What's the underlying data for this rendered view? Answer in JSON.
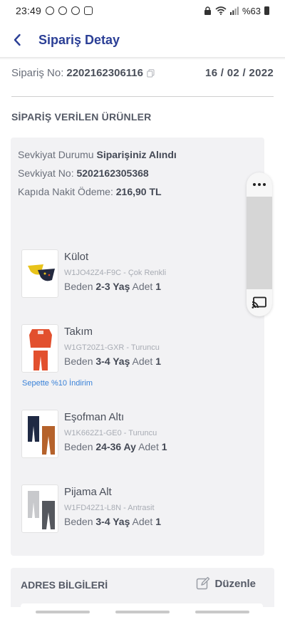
{
  "status_bar": {
    "time": "23:49",
    "battery_text": "%63",
    "icons": [
      "message-icon",
      "whatsapp-icon",
      "whatsapp-icon",
      "instagram-icon",
      "lock-icon",
      "wifi-icon",
      "signal-icon",
      "battery-icon"
    ]
  },
  "header": {
    "title": "Sipariş Detay",
    "back_icon": "chevron-left-icon"
  },
  "order": {
    "label": "Sipariş No:",
    "number": "2202162306116",
    "date": "16 / 02 / 2022"
  },
  "products_section": {
    "title": "SİPARİŞ VERİLEN ÜRÜNLER",
    "shipping_status_label": "Sevkiyat Durumu",
    "shipping_status_value": "Siparişiniz Alındı",
    "shipping_no_label": "Sevkiyat No:",
    "shipping_no_value": "5202162305368",
    "payment_label": "Kapıda Nakit Ödeme:",
    "payment_value": "216,90 TL",
    "items": [
      {
        "name": "Külot",
        "sku": "W1JO42Z4-F9C - Çok Renkli",
        "size_label": "Beden",
        "size": "2-3 Yaş",
        "qty_label": "Adet",
        "qty": "1"
      },
      {
        "name": "Takım",
        "sku": "W1GT20Z1-GXR - Turuncu",
        "size_label": "Beden",
        "size": "3-4 Yaş",
        "qty_label": "Adet",
        "qty": "1"
      },
      {
        "name": "Eşofman Altı",
        "sku": "W1K662Z1-GE0 - Turuncu",
        "size_label": "Beden",
        "size": "24-36 Ay",
        "qty_label": "Adet",
        "qty": "1"
      },
      {
        "name": "Pijama Alt",
        "sku": "W1FD42Z1-L8N - Antrasit",
        "size_label": "Beden",
        "size": "3-4 Yaş",
        "qty_label": "Adet",
        "qty": "1"
      }
    ],
    "discount_note": "Sepette %10 İndirim"
  },
  "address_section": {
    "title": "ADRES BİLGİLERİ",
    "edit_label": "Düzenle"
  },
  "colors": {
    "accent": "#2b3f96",
    "link_blue": "#3a82d8",
    "card_bg": "#f2f2f4"
  }
}
